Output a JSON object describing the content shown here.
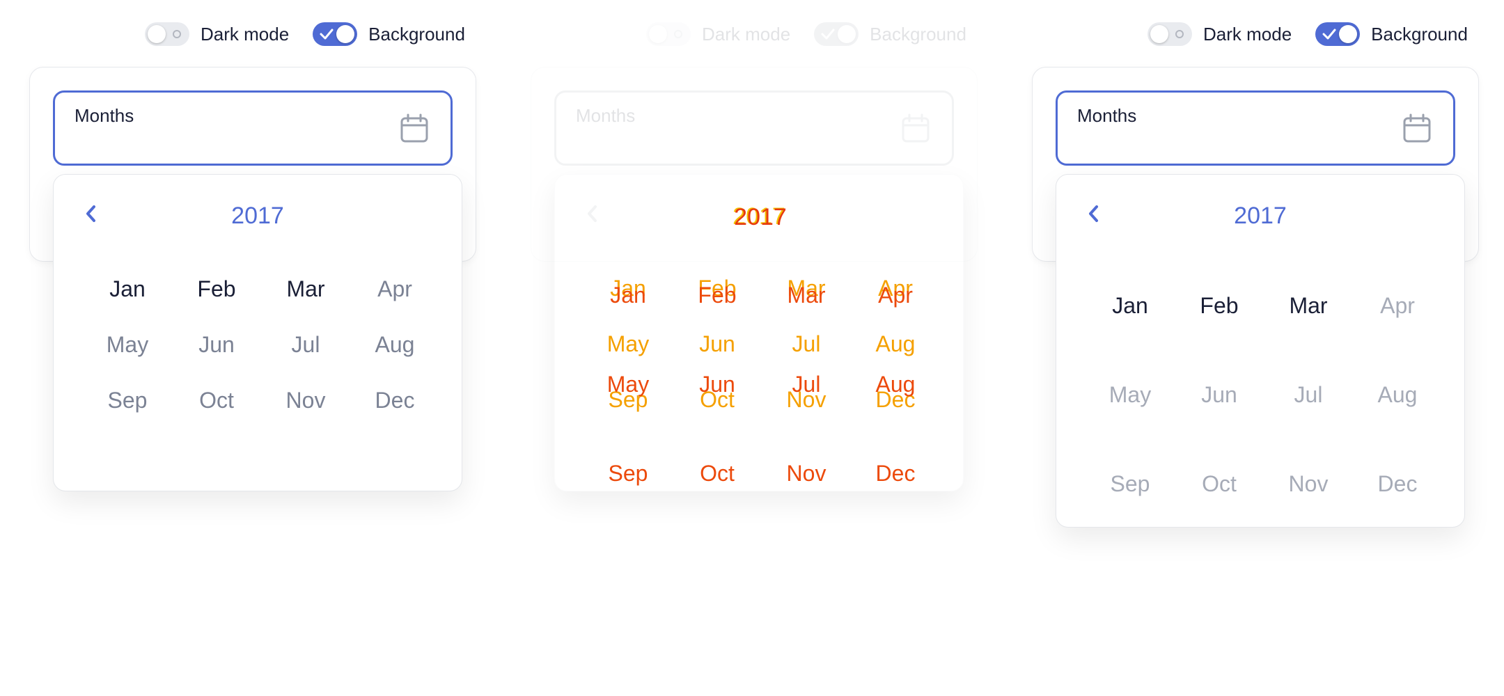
{
  "controls": {
    "dark_mode_label": "Dark mode",
    "background_label": "Background"
  },
  "field": {
    "label": "Months",
    "icon": "calendar-icon"
  },
  "picker": {
    "year": "2017",
    "prev_icon": "chevron-left-icon",
    "months": [
      "Jan",
      "Feb",
      "Mar",
      "Apr",
      "May",
      "Jun",
      "Jul",
      "Aug",
      "Sep",
      "Oct",
      "Nov",
      "Dec"
    ],
    "active_months": [
      "Jan",
      "Feb",
      "Mar"
    ]
  },
  "colors": {
    "accent": "#4f6bd4",
    "text": "#1a1f36",
    "muted": "#7b8294",
    "transition_yellow": "#f5a000",
    "transition_red": "#ec4a0c"
  }
}
